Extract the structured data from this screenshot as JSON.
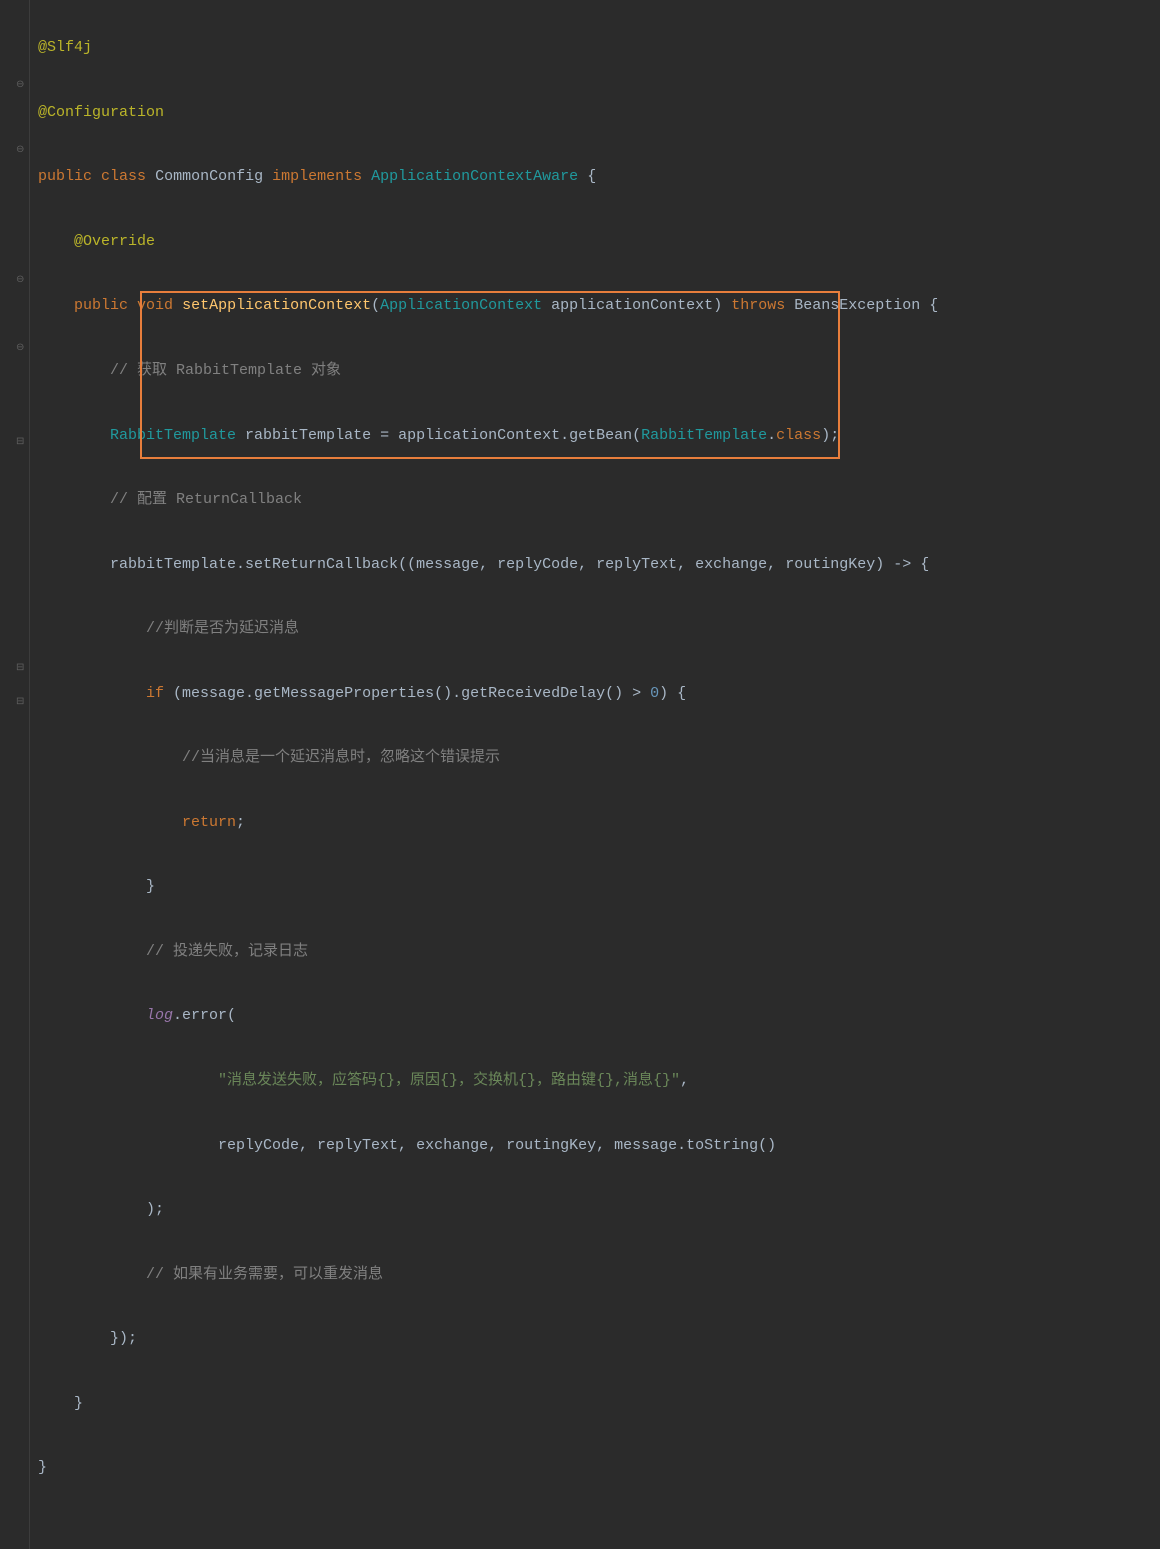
{
  "code": {
    "l1_annotation1": "@Slf4j",
    "l2_annotation2": "@Configuration",
    "l3_public": "public",
    "l3_class": "class",
    "l3_classname": "CommonConfig",
    "l3_implements": "implements",
    "l3_iface": "ApplicationContextAware",
    "l3_brace": " {",
    "l4_override": "@Override",
    "l5_public": "public",
    "l5_void": "void",
    "l5_method": "setApplicationContext",
    "l5_paramtype": "ApplicationContext",
    "l5_paramname": " applicationContext",
    "l5_throws": "throws",
    "l5_exc": "BeansException",
    "l5_brace": " {",
    "l6_comment": "// 获取 RabbitTemplate 对象",
    "l7_type": "RabbitTemplate",
    "l7_var": " rabbitTemplate = applicationContext.getBean(",
    "l7_type2": "RabbitTemplate",
    "l7_dot": ".",
    "l7_class": "class",
    "l7_end": ");",
    "l8_comment": "// 配置 ReturnCallback",
    "l9_text1": "rabbitTemplate.setReturnCallback((message",
    "l9_text2": ", ",
    "l9_p2": "replyCode",
    "l9_p3": "replyText",
    "l9_p4": "exchange",
    "l9_p5": "routingKey",
    "l9_arrow": ") -> {",
    "l10_comment": "//判断是否为延迟消息",
    "l11_if": "if",
    "l11_text": " (message.getMessageProperties().getReceivedDelay() > ",
    "l11_num": "0",
    "l11_end": ") {",
    "l12_comment": "//当消息是一个延迟消息时，忽略这个错误提示",
    "l13_return": "return",
    "l13_semi": ";",
    "l14_brace": "}",
    "l15_comment": "// 投递失败，记录日志",
    "l16_log": "log",
    "l16_error": ".error(",
    "l17_string": "\"消息发送失败，应答码{}，原因{}，交换机{}，路由键{},消息{}\"",
    "l17_comma": ",",
    "l18_args": "replyCode, replyText, exchange, routingKey, message.toString()",
    "l19_close": ");",
    "l20_comment": "// 如果有业务需要，可以重发消息",
    "l21_close": "});",
    "l22_brace": "}",
    "l23_brace": "}"
  }
}
